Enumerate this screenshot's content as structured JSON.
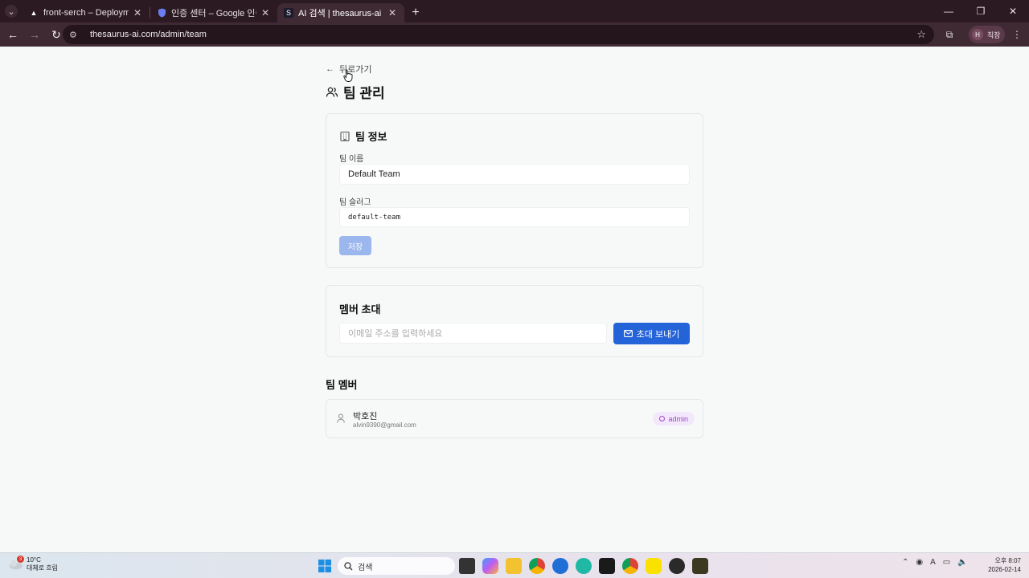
{
  "browser": {
    "tabs": [
      {
        "title": "front-serch – Deployments – V",
        "favicon": "vercel-triangle-icon",
        "active": false
      },
      {
        "title": "인증 센터 – Google 인증 플랫",
        "favicon": "shield-icon",
        "active": false
      },
      {
        "title": "AI 검색 | thesaurus-ai",
        "favicon": "S",
        "active": true
      }
    ],
    "url": "thesaurus-ai.com/admin/team",
    "profile_initial": "H",
    "profile_label": "직장"
  },
  "page": {
    "back_label": "뒤로가기",
    "title": "팀 관리",
    "team_info": {
      "title": "팀 정보",
      "name_label": "팀 이름",
      "name_value": "Default Team",
      "slug_label": "팀 슬러그",
      "slug_value": "default-team",
      "save_label": "저장"
    },
    "invite": {
      "title": "멤버 초대",
      "email_placeholder": "이메일 주소를 입력하세요",
      "button_label": "초대 보내기"
    },
    "members": {
      "title": "팀 멤버",
      "items": [
        {
          "name": "박호진",
          "email": "alvin9390@gmail.com",
          "role": "admin"
        }
      ]
    }
  },
  "taskbar": {
    "weather_temp": "10°C",
    "weather_desc": "대체로 흐림",
    "weather_badge": "3",
    "search_label": "검색",
    "time": "오후 8:07",
    "date": "2026-02-14",
    "colors": {
      "accent": "#2563d9",
      "badge_bg": "#f3e8fb",
      "badge_text": "#9d47c9"
    }
  }
}
